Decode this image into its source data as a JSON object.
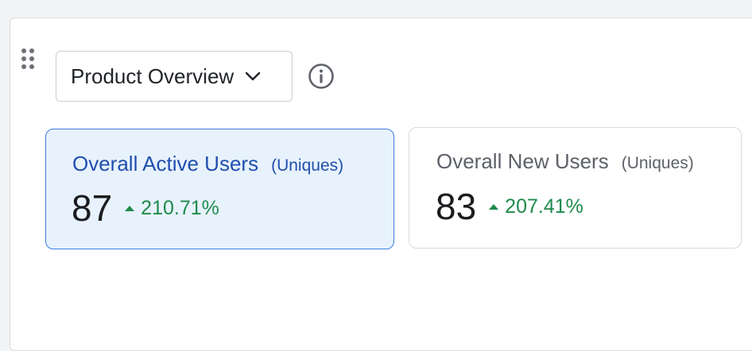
{
  "colors": {
    "accent": "#3b7fe0",
    "selected_bg": "#e8f2fd",
    "positive": "#1f8a4c"
  },
  "header": {
    "dropdown_label": "Product Overview",
    "dropdown_icon": "chevron-down-icon",
    "info_icon": "info-icon",
    "drag_icon": "drag-handle-icon"
  },
  "cards": [
    {
      "title": "Overall Active Users",
      "subtitle": "(Uniques)",
      "value": "87",
      "delta": "210.71%",
      "trend": "up",
      "selected": true
    },
    {
      "title": "Overall New Users",
      "subtitle": "(Uniques)",
      "value": "83",
      "delta": "207.41%",
      "trend": "up",
      "selected": false
    }
  ]
}
